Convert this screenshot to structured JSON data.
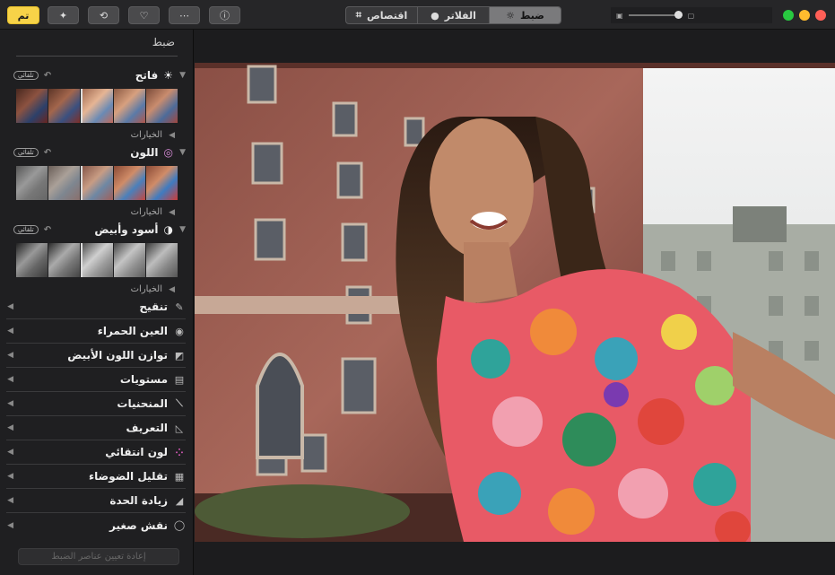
{
  "toolbar": {
    "done_label": "تم",
    "tabs": [
      {
        "label": "ضبط",
        "icon": "sun-adjust-icon",
        "active": true
      },
      {
        "label": "الفلاتر",
        "icon": "filters-circles-icon",
        "active": false
      },
      {
        "label": "اقتصاص",
        "icon": "crop-icon",
        "active": false
      }
    ]
  },
  "sidebar": {
    "title": "ضبط",
    "auto_label": "تلقائي",
    "options_label": "الخيارات",
    "sections": [
      {
        "name": "فاتح",
        "icon": "sun-icon"
      },
      {
        "name": "اللون",
        "icon": "color-wheel-icon"
      },
      {
        "name": "أسود وأبيض",
        "icon": "half-circle-icon"
      }
    ],
    "tools": [
      {
        "name": "تنقيح",
        "icon": "bandage-icon"
      },
      {
        "name": "العين الحمراء",
        "icon": "eye-icon"
      },
      {
        "name": "توازن اللون الأبيض",
        "icon": "white-balance-icon"
      },
      {
        "name": "مستويات",
        "icon": "levels-icon"
      },
      {
        "name": "المنحنيات",
        "icon": "curves-icon"
      },
      {
        "name": "التعريف",
        "icon": "definition-icon"
      },
      {
        "name": "لون انتقائي",
        "icon": "selective-color-icon"
      },
      {
        "name": "تقليل الضوضاء",
        "icon": "noise-icon"
      },
      {
        "name": "زيادة الحدة",
        "icon": "sharpen-icon"
      },
      {
        "name": "نقش صغير",
        "icon": "vignette-icon"
      }
    ],
    "reset_label": "إعادة تعيين عناصر الضبط"
  },
  "colors": {
    "accent": "#f7d348",
    "close": "#ff5f57",
    "minimize": "#febc2e",
    "zoom": "#28c840"
  }
}
